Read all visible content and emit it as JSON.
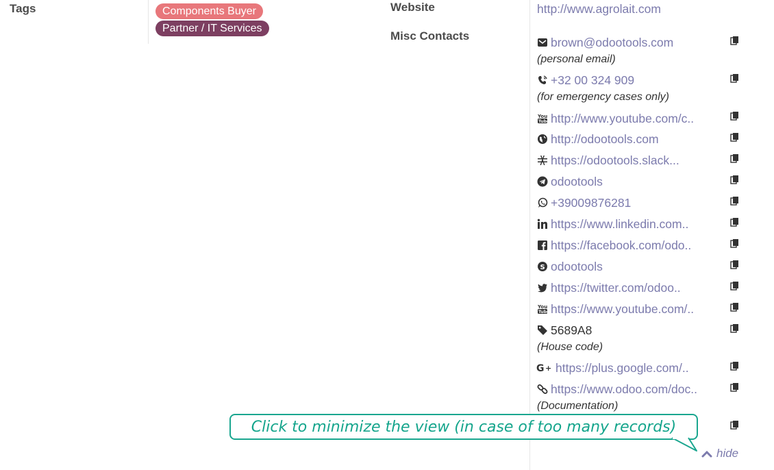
{
  "tags": {
    "label": "Tags",
    "items": [
      {
        "name": "Components Buyer",
        "color": "#e8777b"
      },
      {
        "name": "Partner / IT Services",
        "color": "#7d3f61"
      }
    ]
  },
  "website": {
    "label": "Website",
    "value": "http://www.agrolait.com"
  },
  "misc": {
    "label": "Misc Contacts",
    "contacts": [
      {
        "icon": "envelope-icon",
        "value": "brown@odootools.com",
        "note": "(personal email)"
      },
      {
        "icon": "phone-volume-icon",
        "value": "+32 00 324 909",
        "note": "(for emergency cases only)"
      },
      {
        "icon": "youtube-icon",
        "value": "http://www.youtube.com/c.."
      },
      {
        "icon": "globe-icon",
        "value": "http://odootools.com"
      },
      {
        "icon": "slack-icon",
        "value": "https://odootools.slack..."
      },
      {
        "icon": "telegram-icon",
        "value": "odootools"
      },
      {
        "icon": "whatsapp-icon",
        "value": "+39009876281"
      },
      {
        "icon": "linkedin-icon",
        "value": "https://www.linkedin.com.."
      },
      {
        "icon": "facebook-icon",
        "value": "https://facebook.com/odo.."
      },
      {
        "icon": "skype-icon",
        "value": "odootools"
      },
      {
        "icon": "twitter-icon",
        "value": "https://twitter.com/odoo.."
      },
      {
        "icon": "youtube-icon",
        "value": "https://www.youtube.com/.."
      },
      {
        "icon": "tag-icon",
        "value": "5689A8",
        "note": "(House code)"
      },
      {
        "icon": "google-plus-icon",
        "value": "https://plus.google.com/.."
      },
      {
        "icon": "link-icon",
        "value": "https://www.odoo.com/doc..",
        "note": "(Documentation)"
      }
    ],
    "hide_label": "hide"
  },
  "callout": {
    "text": "Click to minimize the view (in case of too many records)"
  }
}
